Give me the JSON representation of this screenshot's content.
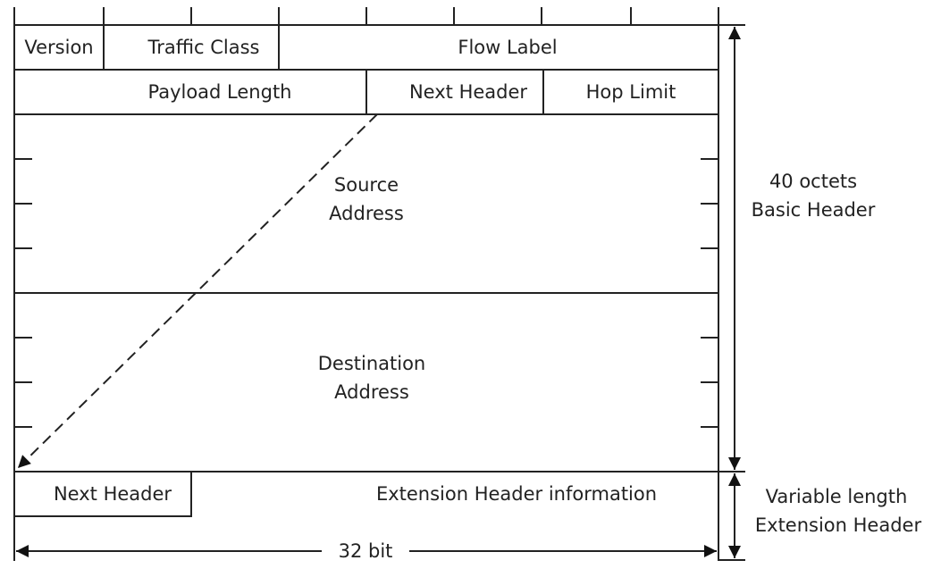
{
  "fields": {
    "version": "Version",
    "traffic_class": "Traffic Class",
    "flow_label": "Flow Label",
    "payload_length": "Payload Length",
    "next_header": "Next Header",
    "hop_limit": "Hop Limit",
    "source_line1": "Source",
    "source_line2": "Address",
    "destination_line1": "Destination",
    "destination_line2": "Address",
    "ext_next_header": "Next Header",
    "ext_info": "Extension Header information"
  },
  "annotations": {
    "basic_line1": "40 octets",
    "basic_line2": "Basic Header",
    "ext_line1": "Variable length",
    "ext_line2": "Extension Header",
    "width_label": "32 bit"
  }
}
